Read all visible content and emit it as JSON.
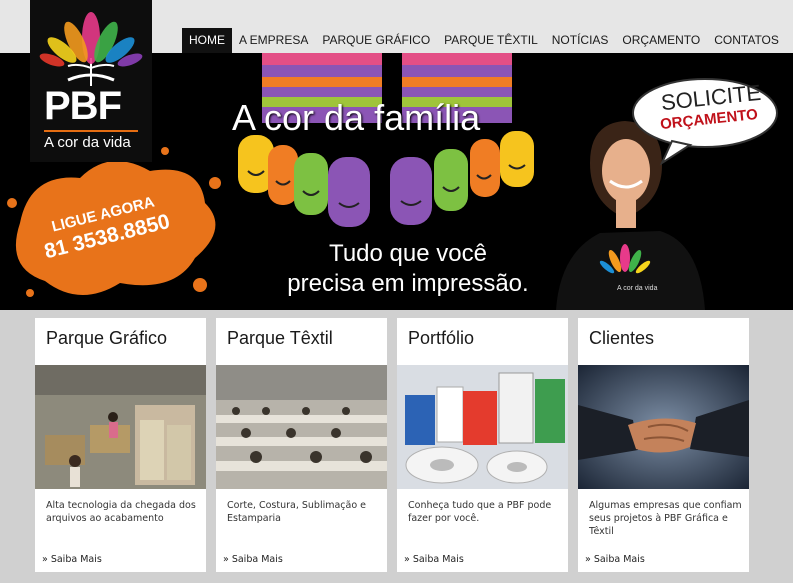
{
  "brand": {
    "name": "PBF",
    "tagline": "A cor da vida",
    "accent": "#e56d12"
  },
  "nav": {
    "items": [
      {
        "label": "Home",
        "active": true
      },
      {
        "label": "A Empresa",
        "active": false
      },
      {
        "label": "Parque Gráfico",
        "active": false
      },
      {
        "label": "Parque Têxtil",
        "active": false
      },
      {
        "label": "Notícias",
        "active": false
      },
      {
        "label": "Orçamento",
        "active": false
      },
      {
        "label": "Contatos",
        "active": false
      }
    ]
  },
  "banner": {
    "headline": "A cor da família",
    "subline1": "Tudo que você",
    "subline2": "precisa em impressão.",
    "call_label": "LIGUE AGORA",
    "phone": "81 3538.8850",
    "bubble_line1": "SOLICITE",
    "bubble_line2": "ORÇAMENTO",
    "shirt_text": "A cor da vida"
  },
  "cards": [
    {
      "title": "Parque Gráfico",
      "desc": "Alta tecnologia da chegada dos arquivos ao acabamento",
      "more": "» Saiba Mais"
    },
    {
      "title": "Parque Têxtil",
      "desc": "Corte, Costura, Sublimação e Estamparia",
      "more": "» Saiba Mais"
    },
    {
      "title": "Portfólio",
      "desc": "Conheça tudo que a PBF pode fazer por você.",
      "more": "» Saiba Mais"
    },
    {
      "title": "Clientes",
      "desc": "Algumas empresas que confiam seus projetos à PBF Gráfica e Têxtil",
      "more": "» Saiba Mais"
    }
  ]
}
